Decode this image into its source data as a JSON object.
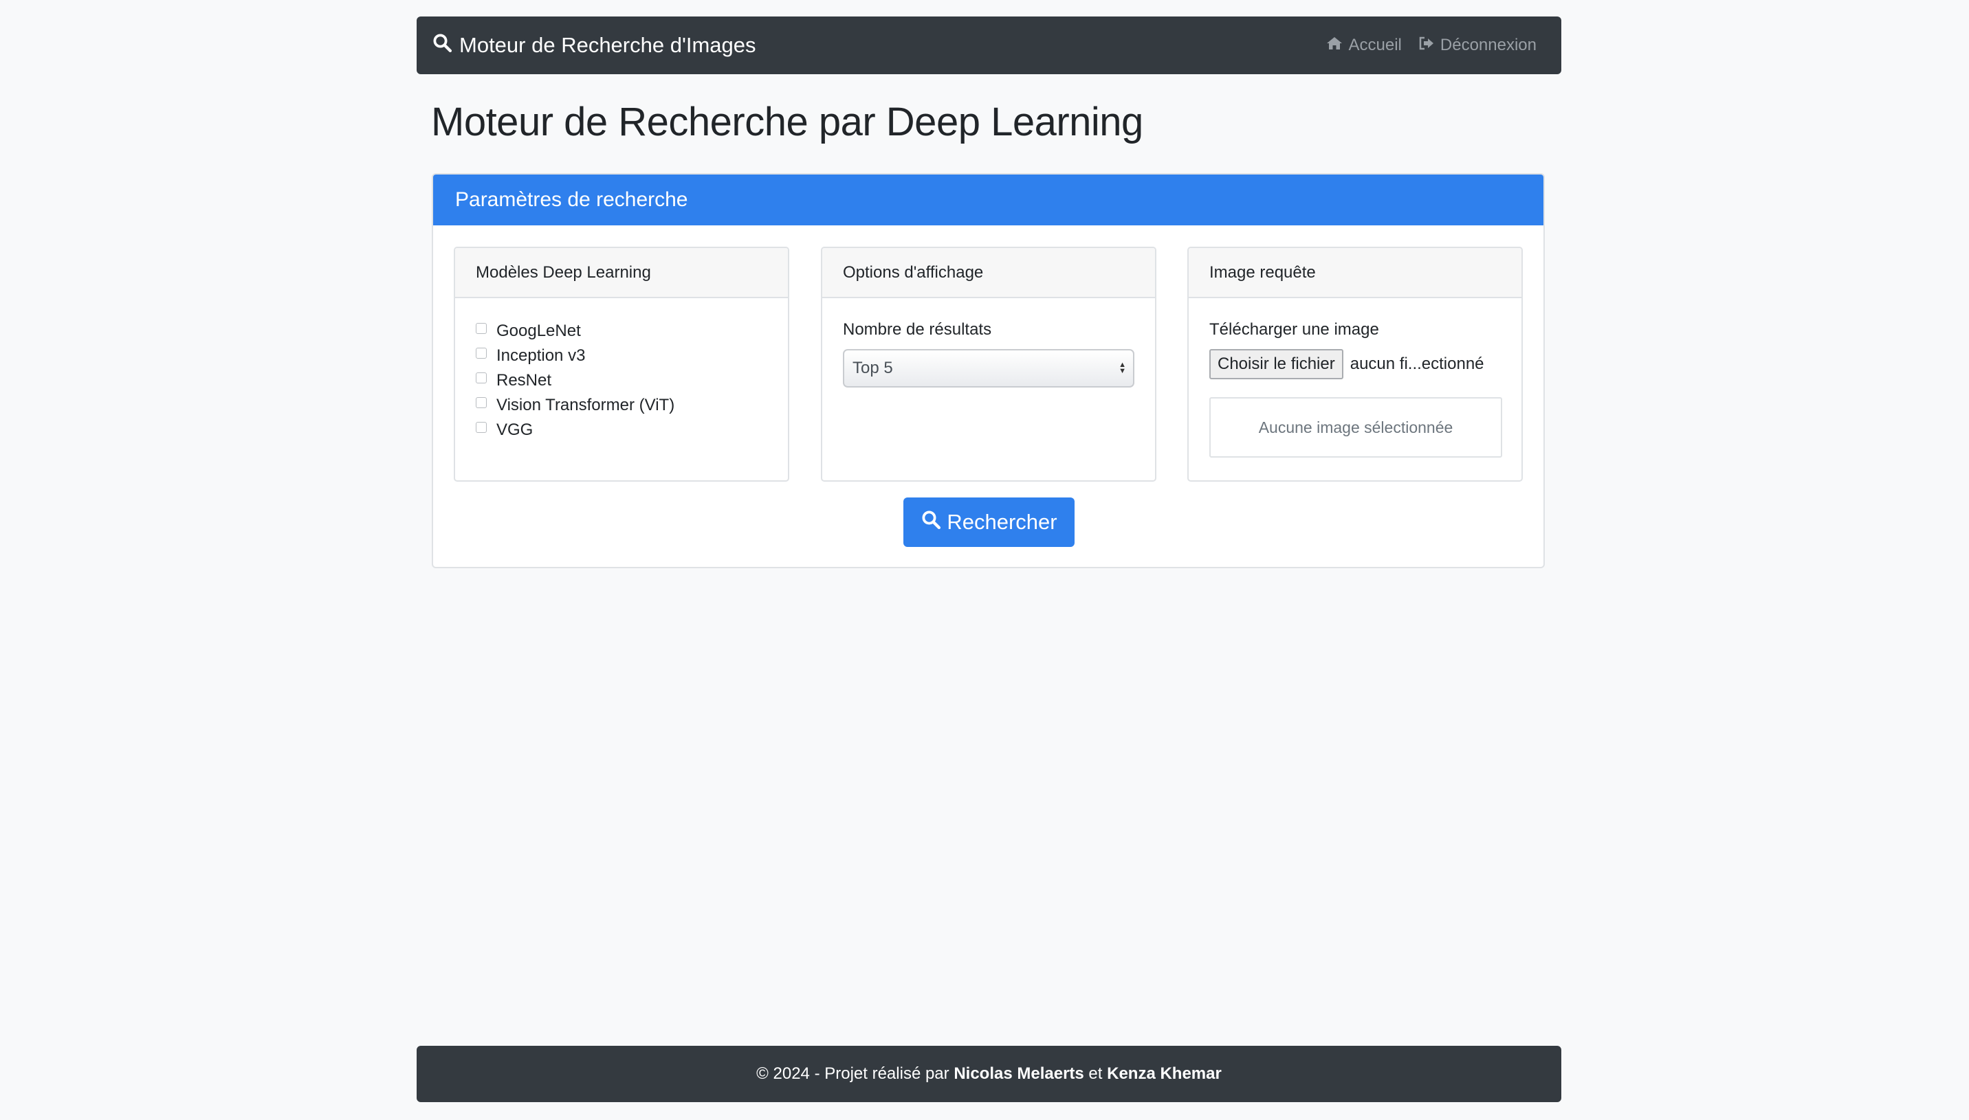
{
  "navbar": {
    "brand": "Moteur de Recherche d'Images",
    "links": [
      {
        "label": "Accueil",
        "icon": "home-icon"
      },
      {
        "label": "Déconnexion",
        "icon": "sign-out-icon"
      }
    ]
  },
  "page": {
    "title": "Moteur de Recherche par Deep Learning"
  },
  "params": {
    "header": "Paramètres de recherche",
    "models": {
      "header": "Modèles Deep Learning",
      "items": [
        {
          "label": "GoogLeNet",
          "checked": false
        },
        {
          "label": "Inception v3",
          "checked": false
        },
        {
          "label": "ResNet",
          "checked": false
        },
        {
          "label": "Vision Transformer (ViT)",
          "checked": false
        },
        {
          "label": "VGG",
          "checked": false
        }
      ]
    },
    "display": {
      "header": "Options d'affichage",
      "results_label": "Nombre de résultats",
      "results_value": "Top 5"
    },
    "query": {
      "header": "Image requête",
      "upload_label": "Télécharger une image",
      "file_button": "Choisir le fichier",
      "file_name": "aucun fi...ectionné",
      "preview_text": "Aucune image sélectionnée"
    },
    "search_button": "Rechercher"
  },
  "footer": {
    "prefix": "© 2024 - Projet réalisé par",
    "author1": "Nicolas Melaerts",
    "conjunction": "et",
    "author2": "Kenza Khemar"
  },
  "colors": {
    "primary": "#2f80ed",
    "dark": "#343a40",
    "background": "#f8f9fa"
  }
}
